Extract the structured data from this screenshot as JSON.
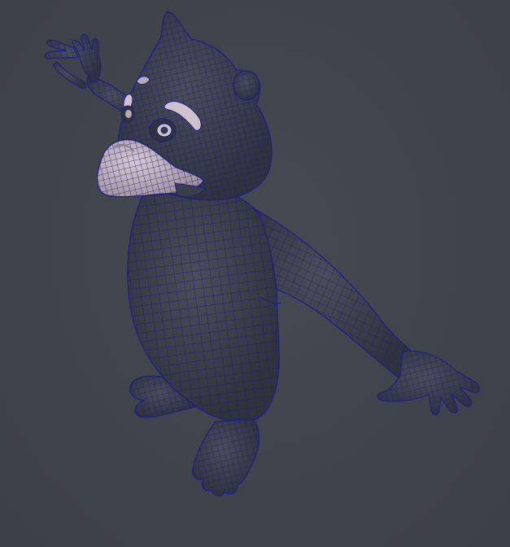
{
  "viewport": {
    "background_color": "#3f434a",
    "model": {
      "name": "",
      "display_mode": "wireframe-on-shaded",
      "wire_color": "#1e1e8c",
      "body_color": "#34383f",
      "muzzle_color": "#b9aab4",
      "eye_color": "#cfc2cc"
    }
  }
}
